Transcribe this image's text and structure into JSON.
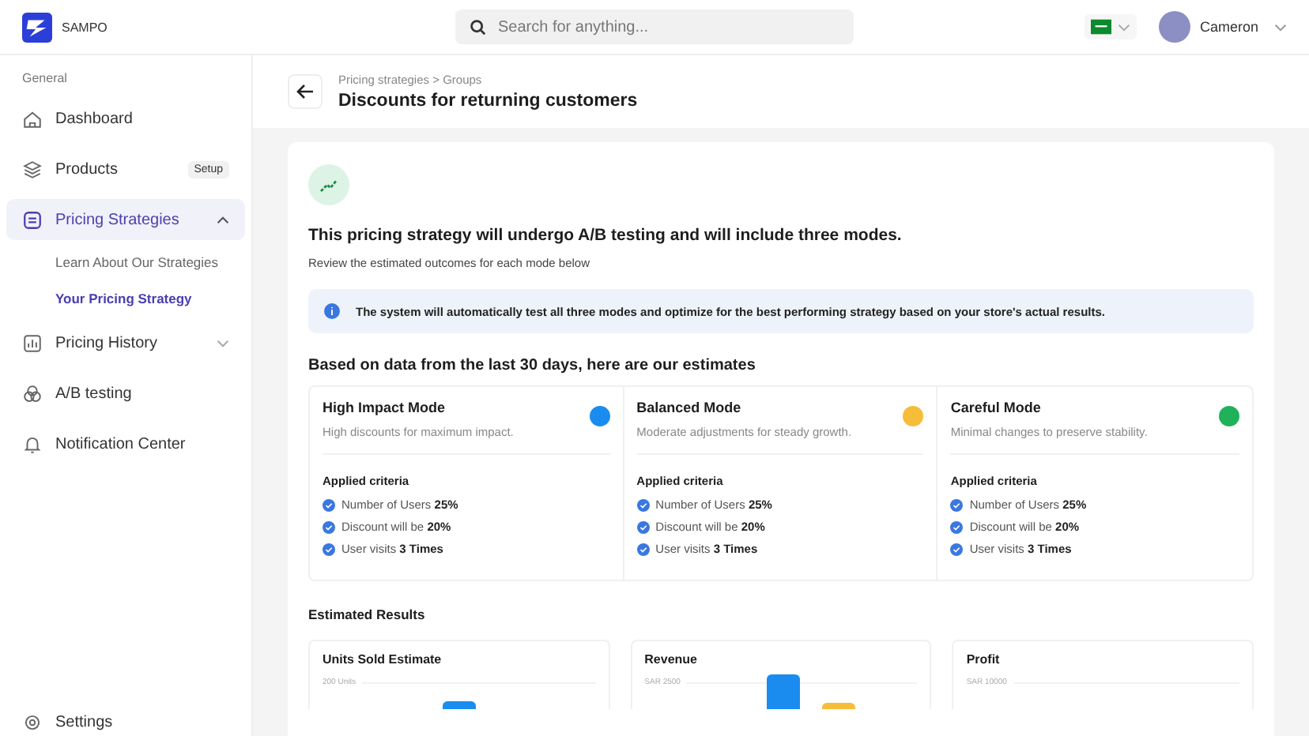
{
  "brand": {
    "name": "SAMPO"
  },
  "search": {
    "placeholder": "Search for anything..."
  },
  "user": {
    "name": "Cameron"
  },
  "sidebar": {
    "section": "General",
    "items": [
      {
        "kind": "plain",
        "label": "Dashboard",
        "selected": false
      },
      {
        "kind": "badge",
        "label": "Products",
        "badge": "Setup",
        "selected": false
      },
      {
        "kind": "group",
        "label": "Pricing Strategies",
        "selected": true,
        "expanded": true,
        "children": [
          {
            "label": "Learn About Our Strategies",
            "selected": false
          },
          {
            "label": "Your Pricing Strategy",
            "selected": true
          }
        ]
      },
      {
        "kind": "group",
        "label": "Pricing History",
        "selected": false,
        "expanded": false
      },
      {
        "kind": "plain",
        "label": "A/B testing",
        "selected": false
      },
      {
        "kind": "plain",
        "label": "Notification Center",
        "selected": false
      }
    ],
    "footer": {
      "label": "Settings"
    }
  },
  "header": {
    "breadcrumb": "Pricing strategies > Groups",
    "title": "Discounts for returning customers"
  },
  "intro": {
    "title": "This pricing strategy will undergo A/B testing and will include three modes.",
    "subtitle": "Review the estimated outcomes for each mode below"
  },
  "notice": "The system will automatically test all three modes and optimize for the best performing strategy based on your store's actual results.",
  "estimates_heading": "Based on data from the last 30 days, here are our estimates",
  "modes": [
    {
      "name": "High Impact Mode",
      "description": "High discounts for maximum impact.",
      "color": "#1a8cf0",
      "criteria_title": "Applied criteria",
      "criteria": [
        "Number of Users **25%**",
        "Discount will be **20%**",
        "User visits **3 Times**"
      ]
    },
    {
      "name": "Balanced Mode",
      "description": "Moderate adjustments for steady growth.",
      "color": "#f5bd3a",
      "criteria_title": "Applied criteria",
      "criteria": [
        "Number of Users **25%**",
        "Discount will be **20%**",
        "User visits **3 Times**"
      ]
    },
    {
      "name": "Careful Mode",
      "description": "Minimal changes to preserve stability.",
      "color": "#1fb25a",
      "criteria_title": "Applied criteria",
      "criteria": [
        "Number of Users **25%**",
        "Discount will be **20%**",
        "User visits **3 Times**"
      ]
    }
  ],
  "results": {
    "title": "Estimated Results",
    "charts": [
      {
        "title": "Units Sold Estimate",
        "top_tick": "200 Units"
      },
      {
        "title": "Revenue",
        "top_tick": "SAR 2500"
      },
      {
        "title": "Profit",
        "top_tick": "SAR 10000"
      }
    ]
  }
}
